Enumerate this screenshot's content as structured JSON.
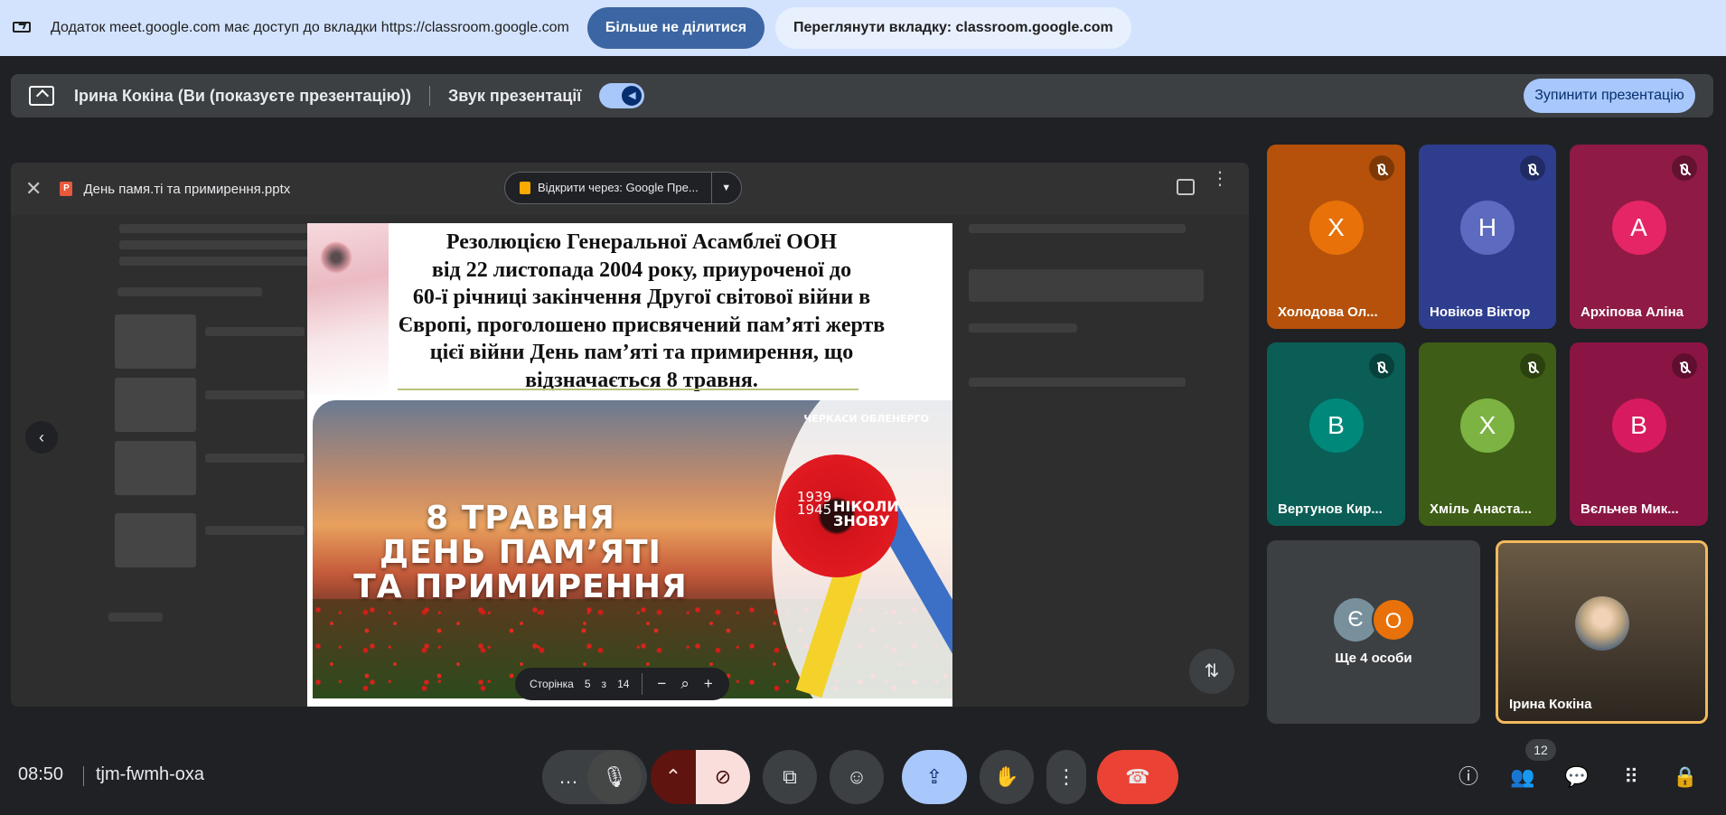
{
  "share_bar": {
    "message": "Додаток meet.google.com має доступ до вкладки https://classroom.google.com",
    "stop_sharing": "Більше не ділитися",
    "view_tab": "Переглянути вкладку: classroom.google.com"
  },
  "present_bar": {
    "presenter": "Ірина Кокіна (Ви (показуєте презентацію))",
    "sound_label": "Звук презентації",
    "sound_on": true,
    "stop_button": "Зупинити презентацію"
  },
  "viewer": {
    "file_name": "День памя.ті та примирення.pptx",
    "open_with": "Відкрити через: Google Пре..."
  },
  "slide": {
    "text_lines": [
      "Резолюцією Генеральної Асамблеї ООН",
      "від 22 листопада 2004 року, приуроченої до",
      "60-ї річниці закінчення Другої світової війни в",
      "Європі, проголошено присвячений пам’яті жертв",
      "цієї війни День пам’яті та примирення, що",
      "відзначається 8 травня."
    ],
    "headline_lines": [
      "8 ТРАВНЯ",
      "ДЕНЬ ПАМ’ЯТІ",
      "ТА ПРИМИРЕННЯ"
    ],
    "brand": "ЧЕРКАСИ ОБЛЕНЕРГО",
    "years": [
      "1939",
      "1945"
    ],
    "never": [
      "НІКОЛИ",
      "ЗНОВУ"
    ],
    "page_label": "Сторінка",
    "page_current": "5",
    "page_of": "з",
    "page_total": "14"
  },
  "participants": [
    {
      "initial": "Х",
      "name": "Холодова Ол...",
      "color": "#b5510a",
      "avatar_color": "#e8710a"
    },
    {
      "initial": "Н",
      "name": "Новіков Віктор",
      "color": "#2f3d8f",
      "avatar_color": "#5c6bc0"
    },
    {
      "initial": "А",
      "name": "Архіпова Аліна",
      "color": "#8e1a45",
      "avatar_color": "#e52565"
    },
    {
      "initial": "В",
      "name": "Вертунов Кир...",
      "color": "#0b5e55",
      "avatar_color": "#00897b"
    },
    {
      "initial": "Х",
      "name": "Хміль Анаста...",
      "color": "#3e5d16",
      "avatar_color": "#7cb342"
    },
    {
      "initial": "В",
      "name": "Вєльчев Мик...",
      "color": "#8a1545",
      "avatar_color": "#d81b60"
    }
  ],
  "more": {
    "initials": [
      "Є",
      "О"
    ],
    "label": "Ще 4 особи"
  },
  "self_tile": {
    "name": "Ірина Кокіна"
  },
  "bottom": {
    "time": "08:50",
    "meeting_code": "tjm-fwmh-oxa",
    "participants_count": "12"
  },
  "icons": {
    "mic": "mic-icon",
    "camera_off": "camera-off-icon",
    "captions": "captions-icon",
    "emoji": "emoji-icon",
    "present": "present-icon",
    "hand": "raise-hand-icon",
    "more": "more-vert-icon",
    "hangup": "hangup-icon",
    "info": "info-icon",
    "people": "people-icon",
    "chat": "chat-icon",
    "apps": "apps-icon",
    "lock": "host-controls-icon"
  }
}
